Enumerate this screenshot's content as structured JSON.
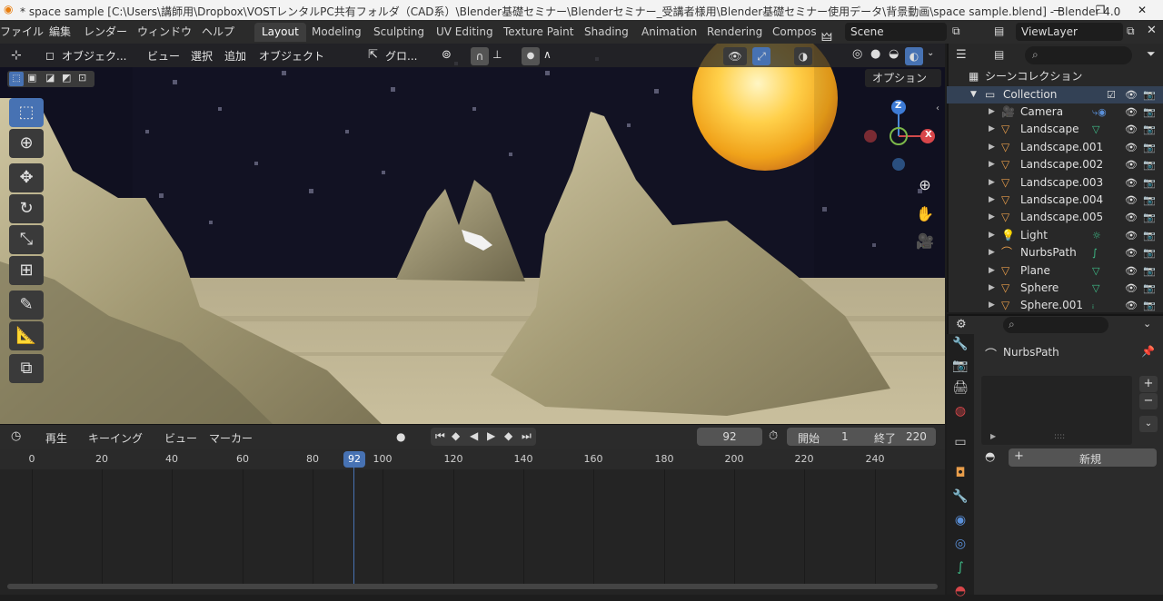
{
  "window": {
    "title": "* space sample [C:\\Users\\講師用\\Dropbox\\VOSTレンタルPC共有フォルダ（CAD系）\\Blender基礎セミナー\\Blenderセミナー_受講者様用\\Blender基礎セミナー使用データ\\背景動画\\space sample.blend] - Blender 4.0",
    "minimize": "—",
    "maximize": "❐",
    "close": "✕"
  },
  "menu": [
    "ファイル",
    "編集",
    "レンダー",
    "ウィンドウ",
    "ヘルプ"
  ],
  "workspaces": [
    "Layout",
    "Modeling",
    "Sculpting",
    "UV Editing",
    "Texture Paint",
    "Shading",
    "Animation",
    "Rendering",
    "Compos"
  ],
  "active_workspace": "Layout",
  "scene": {
    "label": "Scene"
  },
  "view_layer": {
    "label": "ViewLayer"
  },
  "viewport": {
    "mode": "オブジェク...",
    "menus": [
      "ビュー",
      "選択",
      "追加",
      "オブジェクト"
    ],
    "transform_orientation": "グロ...",
    "options": "オプション",
    "gizmo": {
      "z": "Z",
      "x": "X"
    }
  },
  "timeline": {
    "menus": [
      "再生",
      "キーイング",
      "ビュー",
      "マーカー"
    ],
    "current_frame": "92",
    "start_label": "開始",
    "start_value": "1",
    "end_label": "終了",
    "end_value": "220",
    "ruler": [
      "0",
      "20",
      "40",
      "60",
      "80",
      "92",
      "100",
      "120",
      "140",
      "160",
      "180",
      "200",
      "220",
      "240"
    ]
  },
  "outliner": {
    "scene_collection": "シーンコレクション",
    "collection": "Collection",
    "items": [
      {
        "name": "Camera",
        "icon": "camera-icon",
        "color": "#e89d4a"
      },
      {
        "name": "Landscape",
        "icon": "mesh-icon",
        "color": "#e89d4a"
      },
      {
        "name": "Landscape.001",
        "icon": "mesh-icon",
        "color": "#e89d4a"
      },
      {
        "name": "Landscape.002",
        "icon": "mesh-icon",
        "color": "#e89d4a"
      },
      {
        "name": "Landscape.003",
        "icon": "mesh-icon",
        "color": "#e89d4a"
      },
      {
        "name": "Landscape.004",
        "icon": "mesh-icon",
        "color": "#e89d4a"
      },
      {
        "name": "Landscape.005",
        "icon": "mesh-icon",
        "color": "#e89d4a"
      },
      {
        "name": "Light",
        "icon": "light-icon",
        "color": "#e89d4a"
      },
      {
        "name": "NurbsPath",
        "icon": "curve-icon",
        "color": "#e89d4a"
      },
      {
        "name": "Plane",
        "icon": "mesh-icon",
        "color": "#e89d4a"
      },
      {
        "name": "Sphere",
        "icon": "mesh-icon",
        "color": "#e89d4a"
      },
      {
        "name": "Sphere.001",
        "icon": "mesh-icon",
        "color": "#e89d4a"
      }
    ]
  },
  "properties": {
    "object_name": "NurbsPath",
    "new_button": "新規",
    "plus": "+",
    "minus": "−",
    "resize_dots": "::::"
  },
  "colors": {
    "accent": "#4772b3",
    "playhead": "#4772b3",
    "orange": "#e89d4a"
  }
}
